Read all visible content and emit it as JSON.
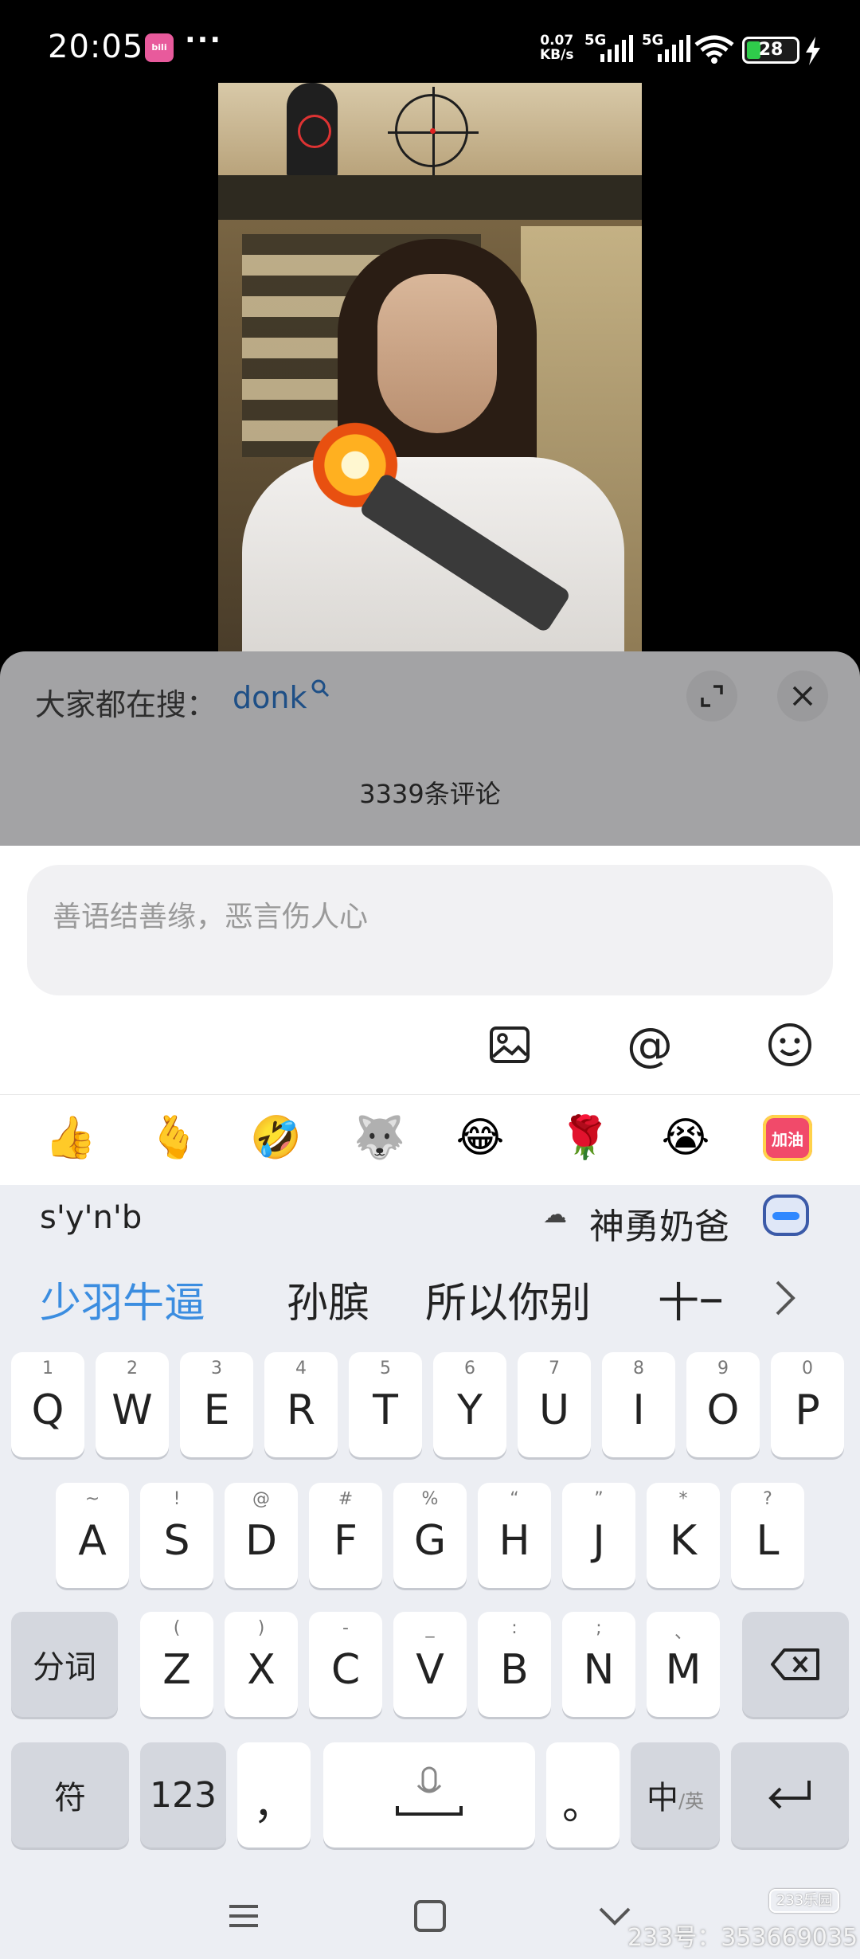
{
  "status_bar": {
    "time": "20:05",
    "app_badge": "bili",
    "more": "···",
    "net_speed_value": "0.07",
    "net_speed_unit": "KB/s",
    "sim1": "5G",
    "sim2": "5G",
    "battery": "28",
    "battery_fill_fraction": 0.28,
    "battery_color": "#2fcc4b"
  },
  "comment_sheet": {
    "search_hint": "大家都在搜：",
    "search_term": "donk",
    "comment_count": "3339条评论",
    "input_placeholder": "善语结善缘，恶言伤人心",
    "tools": [
      "image-icon",
      "at-icon",
      "emoji-icon"
    ],
    "at_symbol": "@",
    "emoji_bar": [
      "👍",
      "🫰",
      "🤣",
      "🐺",
      "😂",
      "🌹",
      "😭"
    ],
    "emoji_badge": "加油"
  },
  "keyboard": {
    "composing_text": "s'y'n'b",
    "cloud_icon": "☁",
    "top_candidate": "神勇奶爸",
    "candidates": [
      "少羽牛逼",
      "孙膑",
      "所以你别",
      "十一"
    ],
    "more_arrow": "›",
    "row1": [
      {
        "label": "Q",
        "sub": "1"
      },
      {
        "label": "W",
        "sub": "2"
      },
      {
        "label": "E",
        "sub": "3"
      },
      {
        "label": "R",
        "sub": "4"
      },
      {
        "label": "T",
        "sub": "5"
      },
      {
        "label": "Y",
        "sub": "6"
      },
      {
        "label": "U",
        "sub": "7"
      },
      {
        "label": "I",
        "sub": "8"
      },
      {
        "label": "O",
        "sub": "9"
      },
      {
        "label": "P",
        "sub": "0"
      }
    ],
    "row2": [
      {
        "label": "A",
        "sub": "~"
      },
      {
        "label": "S",
        "sub": "!"
      },
      {
        "label": "D",
        "sub": "@"
      },
      {
        "label": "F",
        "sub": "#"
      },
      {
        "label": "G",
        "sub": "%"
      },
      {
        "label": "H",
        "sub": "“"
      },
      {
        "label": "J",
        "sub": "”"
      },
      {
        "label": "K",
        "sub": "*"
      },
      {
        "label": "L",
        "sub": "?"
      }
    ],
    "row3": [
      {
        "label": "Z",
        "sub": "("
      },
      {
        "label": "X",
        "sub": ")"
      },
      {
        "label": "C",
        "sub": "-"
      },
      {
        "label": "V",
        "sub": "_"
      },
      {
        "label": "B",
        "sub": ":"
      },
      {
        "label": "N",
        "sub": ";"
      },
      {
        "label": "M",
        "sub": "、"
      }
    ],
    "segment_key": "分词",
    "symbol_key": "符",
    "number_key": "123",
    "comma_key": "，",
    "period_key": "。",
    "lang_key_main": "中",
    "lang_key_sub": "/英"
  },
  "watermark": {
    "id_text": "233号：353669035",
    "logo_text": "233乐园"
  }
}
